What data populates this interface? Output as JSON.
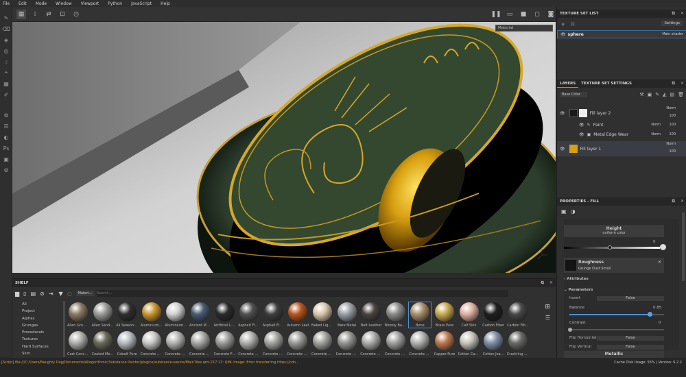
{
  "menu": [
    "File",
    "Edit",
    "Mode",
    "Window",
    "Viewport",
    "Python",
    "JavaScript",
    "Help"
  ],
  "viewport": {
    "material_select": "Material"
  },
  "texture_set_list": {
    "title": "TEXTURE SET LIST",
    "settings_label": "Settings",
    "set_name": "sphere",
    "shader": "Main shader"
  },
  "layers": {
    "tab_layers": "LAYERS",
    "tab_settings": "TEXTURE SET SETTINGS",
    "channel": "Base Color",
    "fill2": {
      "name": "Fill layer 2",
      "blend": "Norm",
      "opacity": "100"
    },
    "paint": {
      "name": "Paint",
      "blend": "Norm",
      "opacity": "100"
    },
    "edge": {
      "name": "Metal Edge Wear",
      "blend": "Norm",
      "opacity": "100"
    },
    "fill1": {
      "name": "Fill layer 1",
      "blend": "Norm",
      "opacity": "100"
    }
  },
  "properties": {
    "title": "PROPERTIES - FILL",
    "height_label": "Height",
    "height_sub": "uniform color",
    "height_value": "0",
    "roughness_label": "Roughness",
    "roughness_sub": "Grunge Dust Small",
    "attributes": "Attributes",
    "parameters": "Parameters",
    "invert_label": "Invert",
    "invert_value": "False",
    "balance_label": "Balance",
    "balance_value": "0.85",
    "balance_fraction": 0.85,
    "contrast_label": "Contrast",
    "contrast_value": "0",
    "flip_h_label": "Flip Horizontal",
    "flip_h_value": "False",
    "flip_v_label": "Flip Vertical",
    "flip_v_value": "False",
    "metallic_label": "Metallic"
  },
  "shelf": {
    "title": "SHELF",
    "filter_tag": "Materi...",
    "search_placeholder": "Search...",
    "categories": [
      "All",
      "Project",
      "Alphas",
      "Grunges",
      "Procedurals",
      "Textures",
      "Hard Surfaces",
      "Skin"
    ],
    "row1": [
      {
        "name": "Alien Growt...",
        "color": "#8a7a64"
      },
      {
        "name": "Alien Sand ...",
        "color": "#9a9a98"
      },
      {
        "name": "All Season T...",
        "color": "#2e2e2e"
      },
      {
        "name": "Aluminium ...",
        "color": "#c9962f"
      },
      {
        "name": "Aluminium ...",
        "color": "#d0d0d0"
      },
      {
        "name": "Ancient Metal",
        "color": "#4a5a70"
      },
      {
        "name": "Artificial Lea...",
        "color": "#2a2a2a"
      },
      {
        "name": "Asphalt Fin...",
        "color": "#505050"
      },
      {
        "name": "Asphalt Fin...",
        "color": "#3e3e3e"
      },
      {
        "name": "Autumn Leaf",
        "color": "#b8561e"
      },
      {
        "name": "Baked Light...",
        "color": "#d8c8ac"
      },
      {
        "name": "Bare Metal",
        "color": "#9aa0a6"
      },
      {
        "name": "Belt Leather",
        "color": "#4a4440"
      },
      {
        "name": "Bloody Batt...",
        "color": "#8a8a88"
      },
      {
        "name": "Bone",
        "color": "#a8906a"
      },
      {
        "name": "Brass Pure",
        "color": "#c8a850"
      },
      {
        "name": "Calf Skin",
        "color": "#e0b0a0"
      },
      {
        "name": "Carbon Fiber",
        "color": "#1e1e1e"
      },
      {
        "name": "Carbon Fib...",
        "color": "#484848"
      }
    ],
    "row2": [
      {
        "name": "Cast Concre...",
        "color": "#b0b0ae"
      },
      {
        "name": "Coated Metal",
        "color": "#6a6a58"
      },
      {
        "name": "Cobalt Pure",
        "color": "#b8bcc2"
      },
      {
        "name": "Concrete B...",
        "color": "#c8c8c6"
      },
      {
        "name": "Concrete Cl...",
        "color": "#b4b4b2"
      },
      {
        "name": "Concrete D...",
        "color": "#a8a8a6"
      },
      {
        "name": "Concrete Fl...",
        "color": "#9c9c9a"
      },
      {
        "name": "Concrete Pl...",
        "color": "#b0b0ae"
      },
      {
        "name": "Concrete Pl...",
        "color": "#a4a4a2"
      },
      {
        "name": "Concrete R...",
        "color": "#9a9a98"
      },
      {
        "name": "Concrete R...",
        "color": "#a2a2a0"
      },
      {
        "name": "Concrete R...",
        "color": "#969694"
      },
      {
        "name": "Concrete Si...",
        "color": "#acacaa"
      },
      {
        "name": "Concrete S...",
        "color": "#a0a09e"
      },
      {
        "name": "Concrete W...",
        "color": "#b2b2b0"
      },
      {
        "name": "Copper Pure",
        "color": "#c07850"
      },
      {
        "name": "Cotton Can...",
        "color": "#c8c4bc"
      },
      {
        "name": "Cotton Jea...",
        "color": "#8090a8"
      },
      {
        "name": "Crackling Li...",
        "color": "#6a6a68"
      }
    ]
  },
  "status": {
    "script": "[Script] file:///C:/Users/Naughty Dog/Documents/Allegorithmic/Substance Painter/plugins/substance-source/MainTiles.qml:217:13: QML Image: Error transferring https://cdn...",
    "disk_label": "Cache Disk Usage:",
    "disk_value": "55%",
    "version": "Version: 6.2.2"
  }
}
